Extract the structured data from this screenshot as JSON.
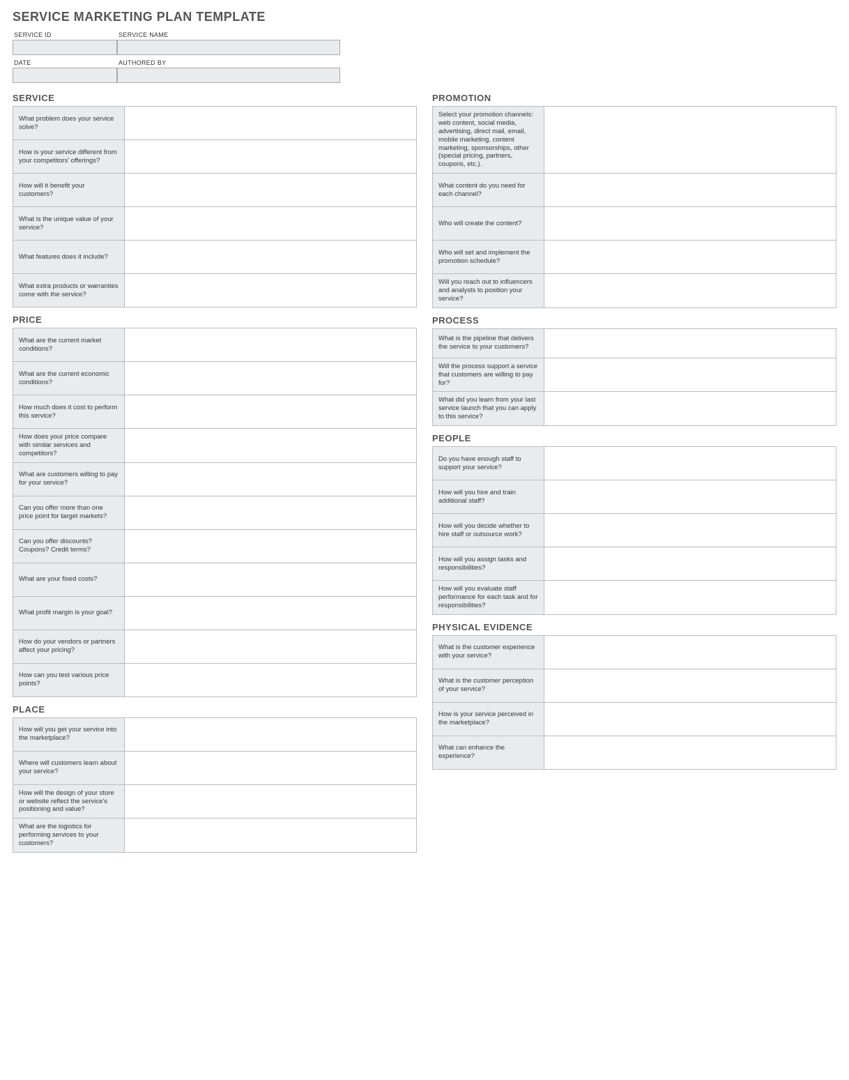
{
  "title": "SERVICE MARKETING PLAN TEMPLATE",
  "meta": {
    "serviceIdLabel": "SERVICE ID",
    "serviceNameLabel": "SERVICE NAME",
    "dateLabel": "DATE",
    "authoredByLabel": "AUTHORED BY",
    "serviceId": "",
    "serviceName": "",
    "date": "",
    "authoredBy": ""
  },
  "sections": {
    "service": {
      "title": "SERVICE",
      "rows": [
        "What problem does your service solve?",
        "How is your service different from your competitors' offerings?",
        "How will it benefit your customers?",
        "What is the unique value of your service?",
        "What features does it include?",
        "What extra products or warranties come with the service?"
      ]
    },
    "price": {
      "title": "PRICE",
      "rows": [
        "What are the current market conditions?",
        "What are the current economic conditions?",
        "How much does it cost to perform this service?",
        "How does your price compare with similar services and competitors?",
        "What are customers willing to pay for your service?",
        "Can you offer more than one price point for target markets?",
        "Can you offer discounts? Coupons? Credit terms?",
        "What are your fixed costs?",
        "What profit margin is your goal?",
        "How do your vendors or partners affect your pricing?",
        "How can you test various price points?"
      ]
    },
    "place": {
      "title": "PLACE",
      "rows": [
        "How will you get your service into the marketplace?",
        "Where will customers learn about your service?",
        "How will the design of your store or website reflect the service's positioning and value?",
        "What are the logistics for performing services to your customers?"
      ]
    },
    "promotion": {
      "title": "PROMOTION",
      "rows": [
        "Select your promotion channels: web content, social media, advertising, direct mail, email, mobile marketing, content marketing, sponsorships, other (special pricing, partners, coupons, etc.).",
        "What content do you need for each channel?",
        "Who will create the content?",
        "Who will set and implement the promotion schedule?",
        "Will you reach out to influencers and analysts to position your service?"
      ]
    },
    "process": {
      "title": "PROCESS",
      "rows": [
        "What is the pipeline that delivers the service to your customers?",
        "Will the process support a service that customers are willing to pay for?",
        "What did you learn from your last service launch that you can apply to this service?"
      ]
    },
    "people": {
      "title": "PEOPLE",
      "rows": [
        "Do you have enough staff to support your service?",
        "How will you hire and train additional staff?",
        "How will you decide whether to hire staff or outsource work?",
        "How will you assign tasks and responsibilities?",
        "How will you evaluate staff performance for each task and for responsibilities?"
      ]
    },
    "evidence": {
      "title": "PHYSICAL EVIDENCE",
      "rows": [
        "What is the customer experience with your service?",
        "What is the customer perception of your service?",
        "How is your service perceived in the marketplace?",
        "What can enhance the experience?"
      ]
    }
  }
}
